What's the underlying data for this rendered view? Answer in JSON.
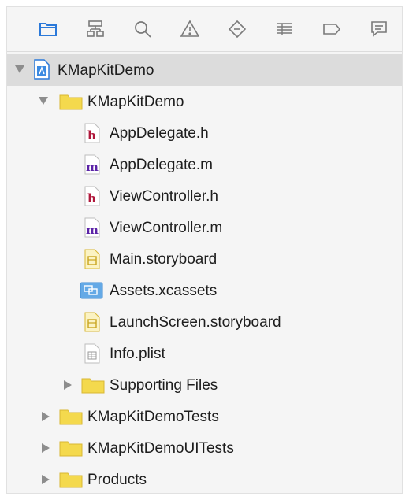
{
  "colors": {
    "h_file": "#b0183b",
    "m_file": "#5b23a7",
    "folder": "#f4d94d",
    "folder_edge": "#d9b834",
    "xcassets": "#64a9e6",
    "toolbar_active": "#2b79d9",
    "toolbar_inactive": "#7a7a7a"
  },
  "toolbar": {
    "icons": [
      {
        "name": "folder-icon"
      },
      {
        "name": "hierarchy-icon"
      },
      {
        "name": "search-icon"
      },
      {
        "name": "warning-icon"
      },
      {
        "name": "diamond-icon"
      },
      {
        "name": "list-icon"
      },
      {
        "name": "breakpoint-icon"
      },
      {
        "name": "speech-bubble-icon"
      }
    ]
  },
  "tree": {
    "project": {
      "label": "KMapKitDemo"
    },
    "group_main": {
      "label": "KMapKitDemo"
    },
    "files": [
      {
        "label": "AppDelegate.h",
        "icon_letter": "h"
      },
      {
        "label": "AppDelegate.m",
        "icon_letter": "m"
      },
      {
        "label": "ViewController.h",
        "icon_letter": "h"
      },
      {
        "label": "ViewController.m",
        "icon_letter": "m"
      },
      {
        "label": "Main.storyboard"
      },
      {
        "label": "Assets.xcassets"
      },
      {
        "label": "LaunchScreen.storyboard"
      },
      {
        "label": "Info.plist"
      }
    ],
    "supporting": {
      "label": "Supporting Files"
    },
    "tests": {
      "label": "KMapKitDemoTests"
    },
    "uitests": {
      "label": "KMapKitDemoUITests"
    },
    "products": {
      "label": "Products"
    }
  }
}
